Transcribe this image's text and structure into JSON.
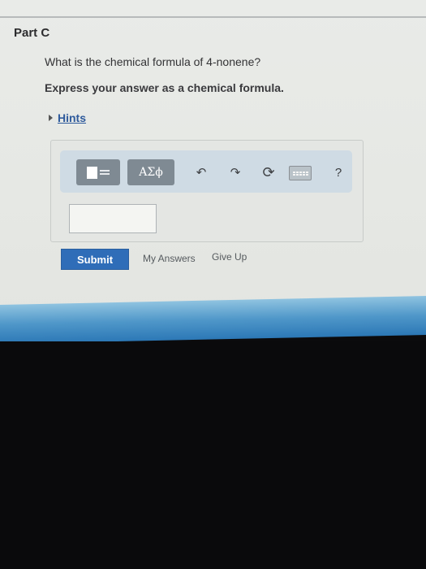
{
  "part": {
    "title": "Part C"
  },
  "question": {
    "text": "What is the chemical formula of 4-nonene?",
    "instruction": "Express your answer as a chemical formula."
  },
  "hints": {
    "label": "Hints"
  },
  "toolbar": {
    "templates_icon": "templates-icon",
    "greek_label": "ΑΣϕ",
    "undo_icon": "undo-icon",
    "undo_glyph": "↶",
    "redo_icon": "redo-icon",
    "redo_glyph": "↷",
    "reset_icon": "reset-icon",
    "reset_glyph": "⟳",
    "keyboard_icon": "keyboard-icon",
    "help_label": "?"
  },
  "answer": {
    "value": "",
    "placeholder": ""
  },
  "actions": {
    "submit_label": "Submit",
    "my_answers_label": "My Answers",
    "give_up_label": "Give Up"
  },
  "colors": {
    "submit_bg": "#2f6db8",
    "hints_link": "#2e5a9c",
    "toolbar_bg": "#cfdbe4"
  }
}
